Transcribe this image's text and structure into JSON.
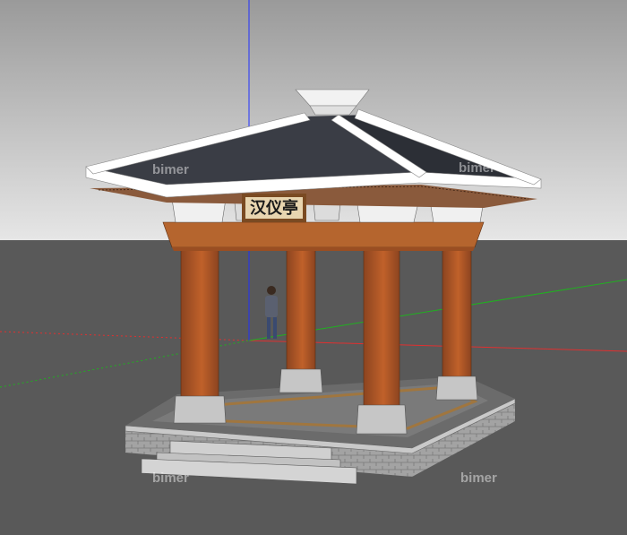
{
  "plaque": {
    "text": "汉仪亭"
  },
  "watermark": {
    "text": "bimer"
  },
  "colors": {
    "sky_top": "#9a9a9a",
    "sky_bottom": "#e6e6e6",
    "ground": "#595959",
    "ground_near": "#4c4c4c",
    "roof": "#3a3d45",
    "roof_edge": "#ffffff",
    "rafters": "#8a5a3c",
    "beam": "#b5652e",
    "column": "#c0612a",
    "column_shadow": "#8c4420",
    "base_stone": "#bdbdbd",
    "brick": "#9a9a9a",
    "floor": "#6b6b6b",
    "floor_trim": "#a0763f",
    "plaque_bg": "#e8d5b0",
    "plaque_frame": "#7a4a22",
    "axis_blue": "#2030ff",
    "axis_red": "#e03030",
    "axis_green": "#20b020"
  }
}
